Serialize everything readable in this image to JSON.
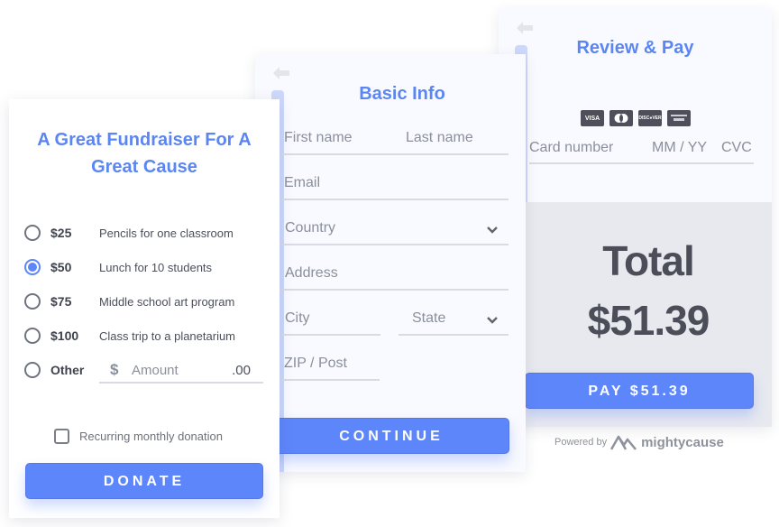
{
  "review_pay": {
    "title": "Review & Pay",
    "back_icon": "arrow-left-icon",
    "card_brands": [
      "VISA",
      "Mastercard",
      "DISCOVER",
      "AMEX"
    ],
    "card_fields": {
      "card_number_placeholder": "Card number",
      "expiry_placeholder": "MM / YY",
      "cvc_placeholder": "CVC"
    },
    "total_label": "Total",
    "total_value": "$51.39",
    "pay_button": "PAY $51.39",
    "powered_by": "Powered by",
    "brand_name": "mightycause"
  },
  "basic_info": {
    "title": "Basic Info",
    "back_icon": "arrow-left-icon",
    "fields": {
      "first_name": "First name",
      "last_name": "Last name",
      "email": "Email",
      "country": "Country",
      "address": "Address",
      "city": "City",
      "state": "State",
      "zip": "ZIP / Post"
    },
    "continue_button": "CONTINUE"
  },
  "fundraiser": {
    "title_line1": "A Great Fundraiser For A",
    "title_line2": "Great Cause",
    "options": [
      {
        "amount": "$25",
        "description": "Pencils for one classroom",
        "selected": false
      },
      {
        "amount": "$50",
        "description": "Lunch for 10 students",
        "selected": true
      },
      {
        "amount": "$75",
        "description": "Middle school art program",
        "selected": false
      },
      {
        "amount": "$100",
        "description": "Class trip to a planetarium",
        "selected": false
      },
      {
        "amount": "Other",
        "description": "",
        "selected": false
      }
    ],
    "other_amount": {
      "currency_symbol": "$",
      "placeholder": "Amount",
      "cents": ".00"
    },
    "recurring_label": "Recurring monthly donation",
    "recurring_checked": false,
    "donate_button": "DONATE"
  },
  "colors": {
    "accent": "#5e86fb",
    "title": "#5b86f2",
    "accent_light": "#cdd8fb",
    "total_bg": "#e8e9ef"
  }
}
